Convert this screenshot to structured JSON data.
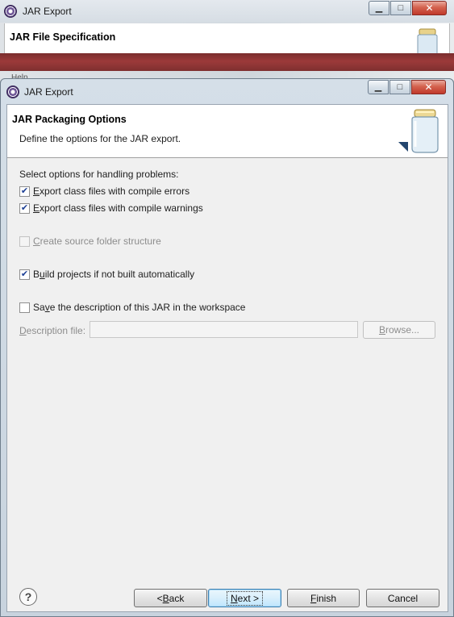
{
  "background_window": {
    "title": "JAR Export",
    "banner_title": "JAR File Specification",
    "help_fragment": "Help"
  },
  "dialog": {
    "title": "JAR Export",
    "window_buttons": {
      "minimize": "▁",
      "maximize": "□",
      "close": "✕"
    },
    "header": {
      "title": "JAR Packaging Options",
      "description": "Define the options for the JAR export."
    },
    "options": {
      "section_label": "Select options for handling problems:",
      "export_errors": {
        "mnemonic": "E",
        "rest": "xport class files with compile errors",
        "checked": true,
        "enabled": true
      },
      "export_warnings": {
        "mnemonic": "E",
        "rest": "xport class files with compile warnings",
        "checked": true,
        "enabled": true
      },
      "source_folder": {
        "mnemonic": "C",
        "rest": "reate source folder structure",
        "checked": false,
        "enabled": false
      },
      "build_projects": {
        "pre": "B",
        "mnemonic": "u",
        "rest": "ild projects if not built automatically",
        "checked": true,
        "enabled": true
      },
      "save_description": {
        "pre": "Sa",
        "mnemonic": "v",
        "rest": "e the description of this JAR in the workspace",
        "checked": false,
        "enabled": true
      }
    },
    "description_file": {
      "mnemonic": "D",
      "rest": "escription file:",
      "value": "",
      "browse": {
        "mnemonic": "B",
        "rest": "rowse..."
      }
    },
    "footer": {
      "help_icon_glyph": "?",
      "back": {
        "pre": "< ",
        "mnemonic": "B",
        "rest": "ack"
      },
      "next": {
        "mnemonic": "N",
        "rest": "ext >"
      },
      "finish": {
        "mnemonic": "F",
        "rest": "inish"
      },
      "cancel": "Cancel"
    }
  },
  "colors": {
    "titlebar": "#d5dfe8",
    "close_button": "#c0392b",
    "focused_button": "#3c7fb1",
    "check_mark": "#1c3f94"
  }
}
